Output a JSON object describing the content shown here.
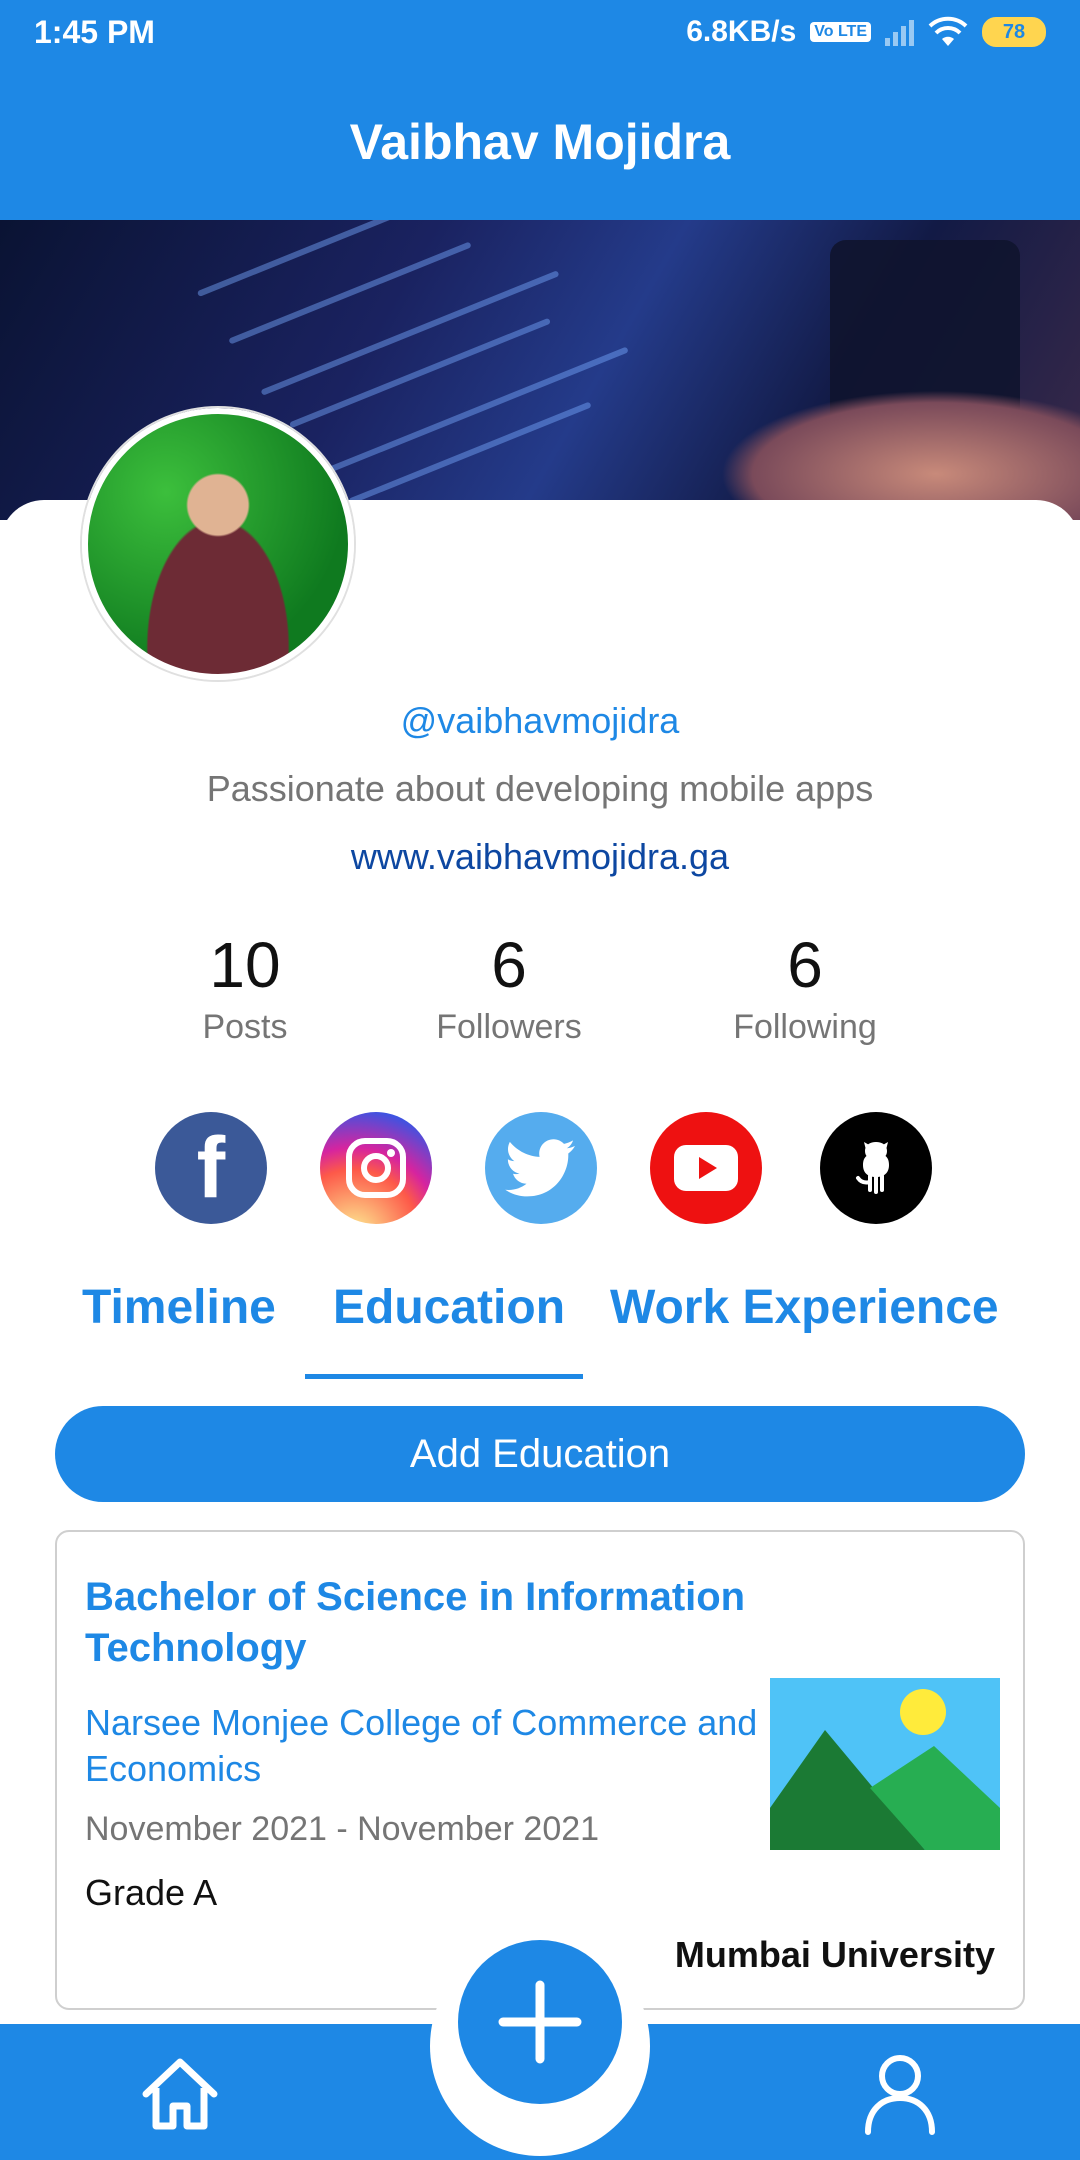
{
  "status_bar": {
    "time": "1:45 PM",
    "network_speed": "6.8KB/s",
    "volte_label": "Vo LTE",
    "battery": "78",
    "icons": [
      "volte-icon",
      "signal-icon",
      "wifi-icon",
      "battery-icon"
    ]
  },
  "app_bar": {
    "title": "Vaibhav Mojidra"
  },
  "profile": {
    "handle": "@vaibhavmojidra",
    "bio": "Passionate about developing mobile apps",
    "website": "www.vaibhavmojidra.ga"
  },
  "stats": [
    {
      "value": "10",
      "label": "Posts"
    },
    {
      "value": "6",
      "label": "Followers"
    },
    {
      "value": "6",
      "label": "Following"
    }
  ],
  "socials": [
    {
      "name": "facebook-icon",
      "glyph": "f",
      "color": "#3b5998"
    },
    {
      "name": "instagram-icon",
      "color": "#d6249f"
    },
    {
      "name": "twitter-icon",
      "color": "#55acee"
    },
    {
      "name": "youtube-icon",
      "color": "#ee1111"
    },
    {
      "name": "github-icon",
      "color": "#000000"
    }
  ],
  "tabs": [
    {
      "label": "Timeline",
      "active": false
    },
    {
      "label": "Education",
      "active": true
    },
    {
      "label": "Work Experience",
      "active": false
    }
  ],
  "add_button": {
    "label": "Add Education"
  },
  "education": [
    {
      "degree": "Bachelor of Science in Information Technology",
      "college": "Narsee Monjee College of Commerce and Economics",
      "dates": "November 2021 - November 2021",
      "grade": "Grade A",
      "university": "Mumbai University",
      "thumbnail_icon": "image-placeholder-icon"
    }
  ],
  "bottom_nav": {
    "items": [
      "home-icon",
      "add-icon",
      "profile-icon"
    ]
  },
  "colors": {
    "primary": "#1e88e5",
    "text_secondary": "#757575",
    "link_dark": "#0d47a1"
  }
}
